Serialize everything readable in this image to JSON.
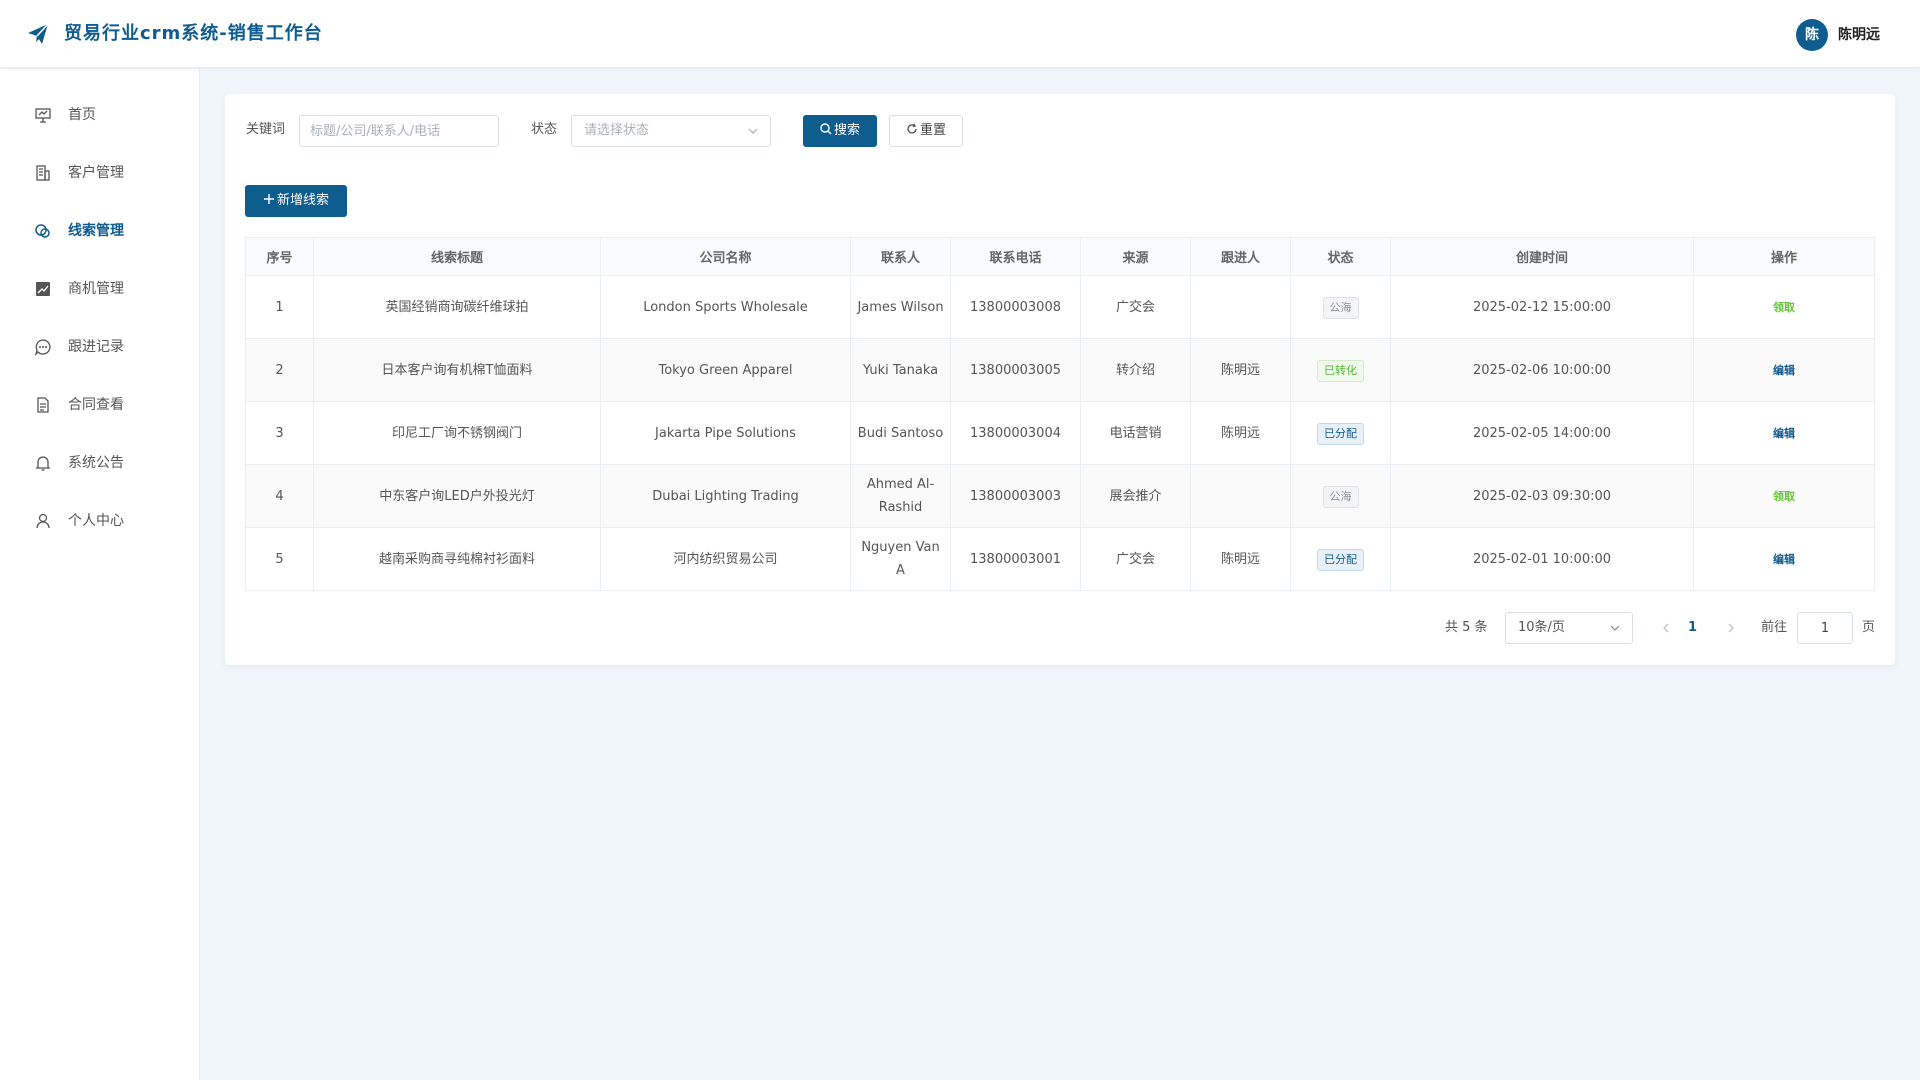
{
  "header": {
    "title": "贸易行业crm系统-销售工作台",
    "avatar_char": "陈",
    "username": "陈明远"
  },
  "sidebar": {
    "items": [
      {
        "label": "首页",
        "icon": "home-icon"
      },
      {
        "label": "客户管理",
        "icon": "building-icon"
      },
      {
        "label": "线索管理",
        "icon": "link-icon",
        "active": true
      },
      {
        "label": "商机管理",
        "icon": "chart-icon"
      },
      {
        "label": "跟进记录",
        "icon": "chat-icon"
      },
      {
        "label": "合同查看",
        "icon": "document-icon"
      },
      {
        "label": "系统公告",
        "icon": "bell-icon"
      },
      {
        "label": "个人中心",
        "icon": "user-icon"
      }
    ]
  },
  "filters": {
    "keyword_label": "关键词",
    "keyword_value": "",
    "keyword_placeholder": "标题/公司/联系人/电话",
    "status_label": "状态",
    "status_placeholder": "请选择状态",
    "search_label": "搜索",
    "reset_label": "重置"
  },
  "toolbar": {
    "add_label": "新增线索"
  },
  "table": {
    "columns": [
      "序号",
      "线索标题",
      "公司名称",
      "联系人",
      "联系电话",
      "来源",
      "跟进人",
      "状态",
      "创建时间",
      "操作"
    ],
    "rows": [
      {
        "index": "1",
        "title": "英国经销商询碳纤维球拍",
        "company": "London Sports Wholesale",
        "contact": "James Wilson",
        "phone": "13800003008",
        "source": "广交会",
        "owner": "",
        "status": "公海",
        "status_type": "gray",
        "created": "2025-02-12 15:00:00",
        "action": "领取",
        "action_type": "green"
      },
      {
        "index": "2",
        "title": "日本客户询有机棉T恤面料",
        "company": "Tokyo Green Apparel",
        "contact": "Yuki Tanaka",
        "phone": "13800003005",
        "source": "转介绍",
        "owner": "陈明远",
        "status": "已转化",
        "status_type": "green",
        "created": "2025-02-06 10:00:00",
        "action": "编辑",
        "action_type": "blue"
      },
      {
        "index": "3",
        "title": "印尼工厂询不锈钢阀门",
        "company": "Jakarta Pipe Solutions",
        "contact": "Budi Santoso",
        "phone": "13800003004",
        "source": "电话营销",
        "owner": "陈明远",
        "status": "已分配",
        "status_type": "blue",
        "created": "2025-02-05 14:00:00",
        "action": "编辑",
        "action_type": "blue"
      },
      {
        "index": "4",
        "title": "中东客户询LED户外投光灯",
        "company": "Dubai Lighting Trading",
        "contact": "Ahmed Al-Rashid",
        "phone": "13800003003",
        "source": "展会推介",
        "owner": "",
        "status": "公海",
        "status_type": "gray",
        "created": "2025-02-03 09:30:00",
        "action": "领取",
        "action_type": "green"
      },
      {
        "index": "5",
        "title": "越南采购商寻纯棉衬衫面料",
        "company": "河内纺织贸易公司",
        "contact": "Nguyen Van A",
        "phone": "13800003001",
        "source": "广交会",
        "owner": "陈明远",
        "status": "已分配",
        "status_type": "blue",
        "created": "2025-02-01 10:00:00",
        "action": "编辑",
        "action_type": "blue"
      }
    ]
  },
  "pagination": {
    "total_text": "共 5 条",
    "page_size": "10条/页",
    "current_page": "1",
    "goto_label": "前往",
    "goto_value": "1",
    "page_unit": "页"
  },
  "colors": {
    "brand": "#0f5c8f",
    "success": "#67c23a",
    "background": "#f0f6fc"
  }
}
